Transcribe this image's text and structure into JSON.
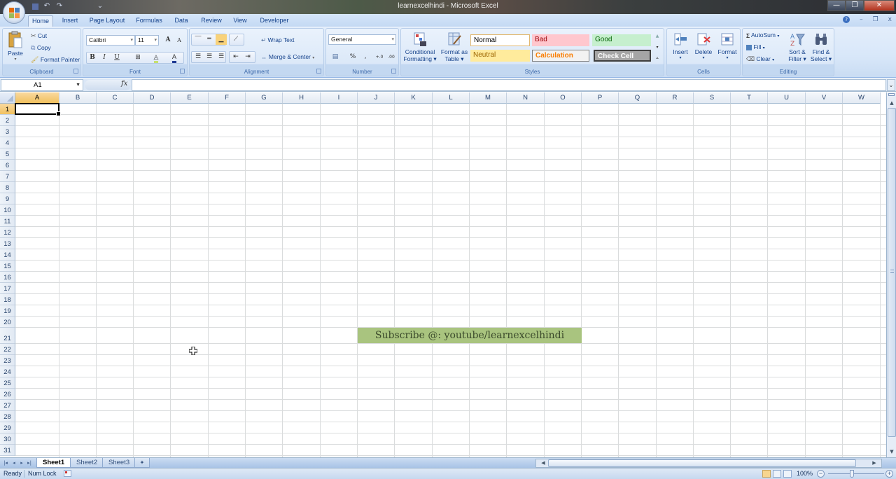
{
  "window": {
    "title": "learnexcelhindi - Microsoft Excel",
    "controls": {
      "minimize": "—",
      "restore": "❐",
      "close": "✕"
    },
    "doc_controls": {
      "help": "?",
      "minimize": "–",
      "restore": "❐",
      "close": "x"
    }
  },
  "qat": {
    "save_icon": "💾",
    "undo_icon": "↶",
    "redo_icon": "↷",
    "customize_icon": "⌄"
  },
  "tabs": [
    {
      "label": "Home",
      "active": true
    },
    {
      "label": "Insert"
    },
    {
      "label": "Page Layout"
    },
    {
      "label": "Formulas"
    },
    {
      "label": "Data"
    },
    {
      "label": "Review"
    },
    {
      "label": "View"
    },
    {
      "label": "Developer"
    }
  ],
  "ribbon": {
    "clipboard": {
      "label": "Clipboard",
      "paste": "Paste",
      "cut": "Cut",
      "copy": "Copy",
      "format_painter": "Format Painter"
    },
    "font": {
      "label": "Font",
      "font_name": "Calibri",
      "font_size": "11",
      "grow": "A",
      "shrink": "A",
      "bold": "B",
      "italic": "I",
      "underline": "U",
      "font_color_letter": "A",
      "font_color": "#1f3a93",
      "fill_color": "#c6e070"
    },
    "alignment": {
      "label": "Alignment",
      "wrap_text": "Wrap Text",
      "merge_center": "Merge & Center"
    },
    "number": {
      "label": "Number",
      "format": "General",
      "percent": "%",
      "comma": ",",
      "inc_decimal": "+.0",
      "dec_decimal": ".00"
    },
    "styles": {
      "label": "Styles",
      "conditional_formatting": [
        "Conditional",
        "Formatting"
      ],
      "format_as_table": [
        "Format as",
        "Table"
      ],
      "cells": [
        {
          "name": "Normal",
          "bg": "#ffffff",
          "fg": "#000000",
          "border": "#e1b871"
        },
        {
          "name": "Bad",
          "bg": "#ffc7ce",
          "fg": "#9c0006"
        },
        {
          "name": "Good",
          "bg": "#c6efce",
          "fg": "#006100"
        },
        {
          "name": "Neutral",
          "bg": "#ffeb9c",
          "fg": "#9c6500"
        },
        {
          "name": "Calculation",
          "bg": "#f2f2f2",
          "fg": "#fa7d00",
          "border": "#7f7f7f"
        },
        {
          "name": "Check Cell",
          "bg": "#a5a5a5",
          "fg": "#ffffff",
          "border": "#3f3f3f"
        }
      ]
    },
    "cells": {
      "label": "Cells",
      "insert": "Insert",
      "delete": "Delete",
      "format": "Format"
    },
    "editing": {
      "label": "Editing",
      "autosum": "AutoSum",
      "fill": "Fill",
      "clear": "Clear",
      "sort_filter": [
        "Sort &",
        "Filter"
      ],
      "find_select": [
        "Find &",
        "Select"
      ]
    }
  },
  "formula_bar": {
    "name_box": "A1",
    "fx": "fx",
    "formula": ""
  },
  "sheet": {
    "columns": [
      "A",
      "B",
      "C",
      "D",
      "E",
      "F",
      "G",
      "H",
      "I",
      "J",
      "K",
      "L",
      "M",
      "N",
      "O",
      "P",
      "Q",
      "R",
      "S",
      "T",
      "U",
      "V",
      "W"
    ],
    "rows": [
      "1",
      "2",
      "3",
      "4",
      "5",
      "6",
      "7",
      "8",
      "9",
      "10",
      "11",
      "12",
      "13",
      "14",
      "15",
      "16",
      "17",
      "18",
      "19",
      "20",
      "21",
      "22",
      "23",
      "24",
      "25",
      "26",
      "27",
      "28",
      "29",
      "30",
      "31"
    ],
    "active_cell": "A1",
    "banner_text": "Subscribe @: youtube/learnexcelhindi",
    "banner_bg": "#a9c47f"
  },
  "sheet_tabs": [
    {
      "label": "Sheet1",
      "active": true
    },
    {
      "label": "Sheet2"
    },
    {
      "label": "Sheet3"
    }
  ],
  "status": {
    "ready": "Ready",
    "num_lock": "Num Lock",
    "zoom": "100%",
    "zoom_minus": "−",
    "zoom_plus": "+",
    "zoom_level_percent": 100
  }
}
